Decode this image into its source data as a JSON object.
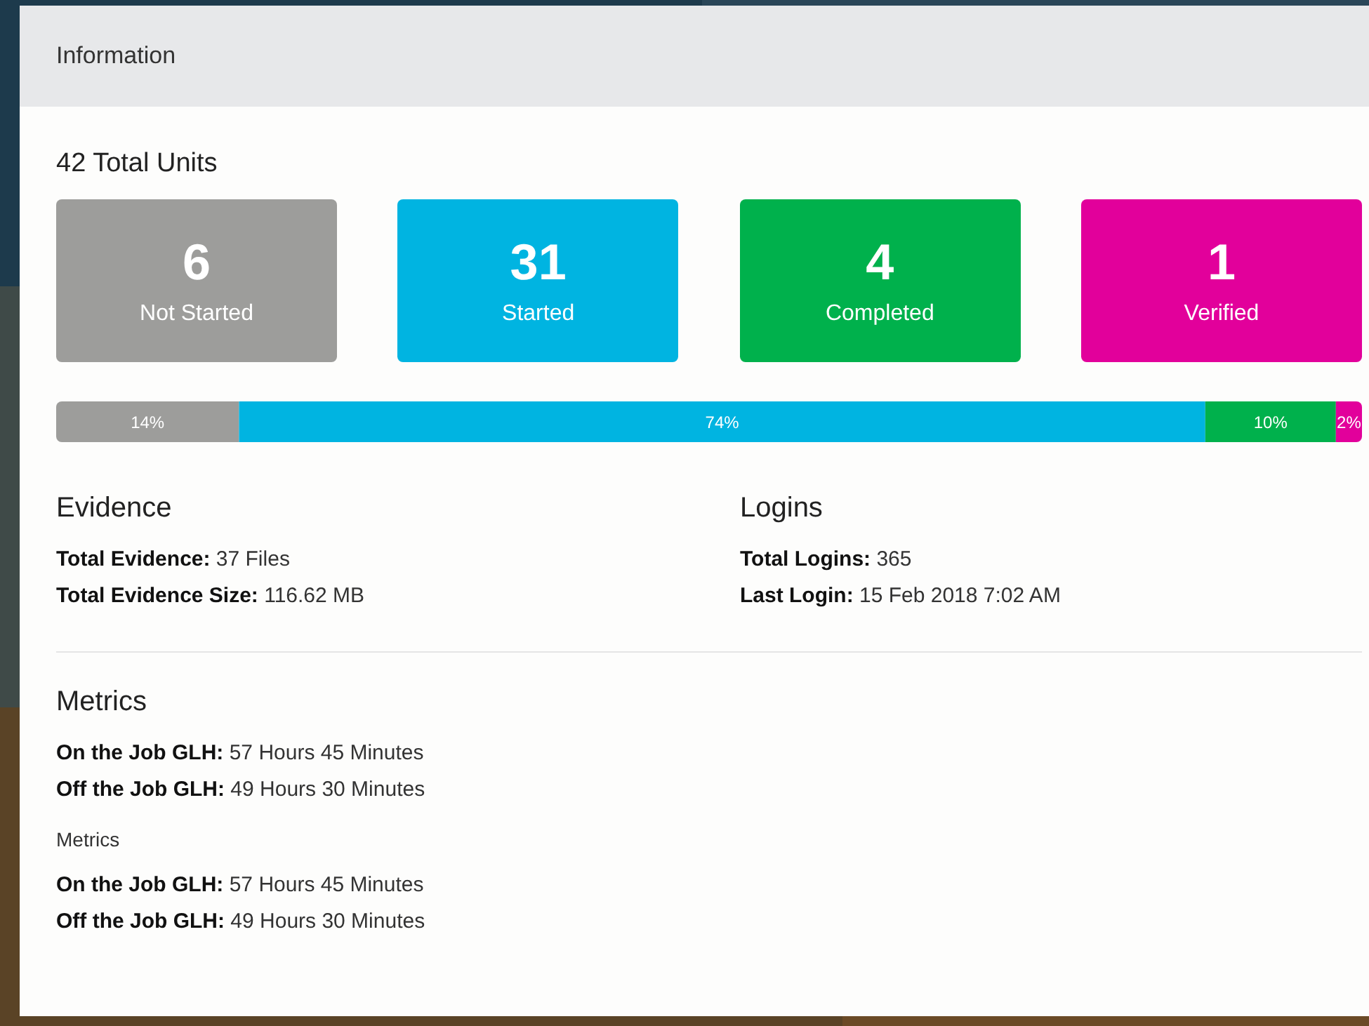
{
  "panel": {
    "title": "Information"
  },
  "total_units": "42 Total Units",
  "status_tiles": [
    {
      "count": "6",
      "label": "Not Started",
      "color": "#9d9d9b"
    },
    {
      "count": "31",
      "label": "Started",
      "color": "#00b4e1"
    },
    {
      "count": "4",
      "label": "Completed",
      "color": "#00b14c"
    },
    {
      "count": "1",
      "label": "Verified",
      "color": "#e2009b"
    }
  ],
  "progress": {
    "chart_data": {
      "type": "bar",
      "orientation": "horizontal",
      "stacked": true,
      "series": [
        {
          "color": "#9d9d9b",
          "values": [
            14
          ],
          "value_labels": [
            "14%"
          ]
        },
        {
          "color": "#00b4e1",
          "values": [
            74
          ],
          "value_labels": [
            "74%"
          ]
        },
        {
          "color": "#00b14c",
          "values": [
            10
          ],
          "value_labels": [
            "10%"
          ]
        },
        {
          "color": "#e2009b",
          "values": [
            2
          ],
          "value_labels": [
            "2%"
          ]
        }
      ]
    }
  },
  "evidence": {
    "heading": "Evidence",
    "lines": [
      {
        "label": "Total Evidence:",
        "value": "37 Files"
      },
      {
        "label": "Total Evidence Size:",
        "value": "116.62 MB"
      }
    ]
  },
  "logins": {
    "heading": "Logins",
    "lines": [
      {
        "label": "Total Logins:",
        "value": "365"
      },
      {
        "label": "Last Login:",
        "value": "15 Feb 2018 7:02 AM"
      }
    ]
  },
  "metrics": {
    "heading": "Metrics",
    "lines": [
      {
        "label": "On the Job GLH:",
        "value": "57 Hours 45 Minutes"
      },
      {
        "label": "Off the Job GLH:",
        "value": "49 Hours 30 Minutes"
      }
    ],
    "subheading": "Metrics",
    "sub_lines": [
      {
        "label": "On the Job GLH:",
        "value": "57 Hours 45 Minutes"
      },
      {
        "label": "Off the Job GLH:",
        "value": "49 Hours 30 Minutes"
      }
    ]
  }
}
